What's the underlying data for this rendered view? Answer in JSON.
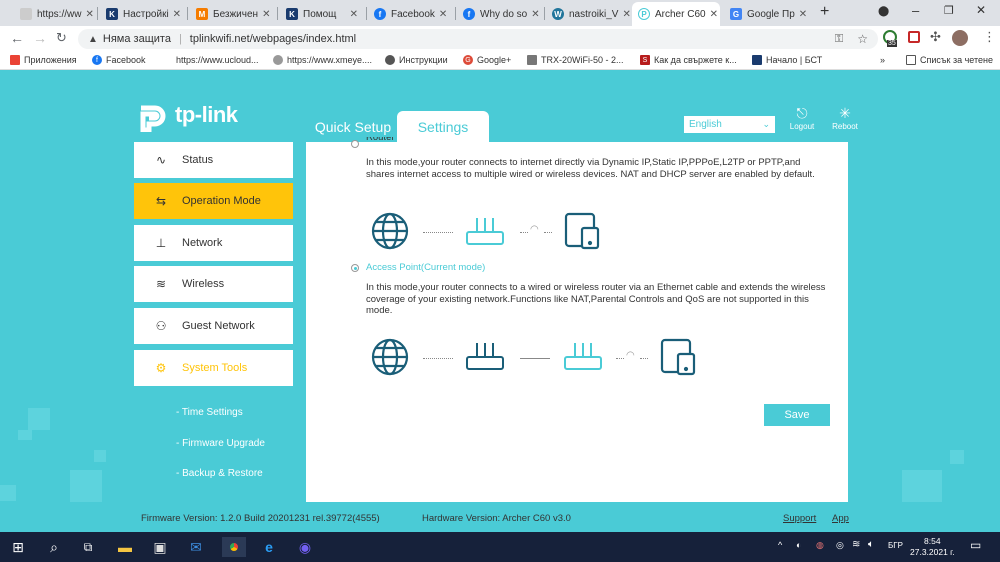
{
  "browser": {
    "tabs": [
      {
        "label": "https://ww",
        "icon": "page-icon"
      },
      {
        "label": "Настройкі",
        "icon": "k-icon"
      },
      {
        "label": "Безжичен",
        "icon": "m-icon"
      },
      {
        "label": "Помощ",
        "icon": "k-icon"
      },
      {
        "label": "Facebook",
        "icon": "facebook-icon"
      },
      {
        "label": "Why do so",
        "icon": "facebook-icon"
      },
      {
        "label": "nastroiki_V",
        "icon": "wordpress-icon"
      },
      {
        "label": "Archer C60",
        "icon": "tplink-icon"
      },
      {
        "label": "Google Пр",
        "icon": "google-translate-icon"
      }
    ],
    "new_tab": "+",
    "security_label": "Няма защита",
    "url": "tplinkwifi.net/webpages/index.html",
    "extension_badge": "35",
    "bookmarks": [
      {
        "label": "Приложения"
      },
      {
        "label": "Facebook"
      },
      {
        "label": "https://www.ucloud..."
      },
      {
        "label": "https://www.xmeye...."
      },
      {
        "label": "Инструкции"
      },
      {
        "label": "Google+"
      },
      {
        "label": "TRX-20WiFi-50 - 2..."
      },
      {
        "label": "Как да свържете к..."
      },
      {
        "label": "Начало | БСТ"
      }
    ],
    "bookmarks_more": "»",
    "reading_list": "Списък за четене"
  },
  "router": {
    "brand": "tp-link",
    "tabs": {
      "quick_setup": "Quick Setup",
      "settings": "Settings"
    },
    "language": "English",
    "logout": "Logout",
    "reboot": "Reboot",
    "menu": [
      {
        "label": "Status",
        "icon": "status-icon"
      },
      {
        "label": "Operation Mode",
        "icon": "operation-mode-icon"
      },
      {
        "label": "Network",
        "icon": "network-icon"
      },
      {
        "label": "Wireless",
        "icon": "wireless-icon"
      },
      {
        "label": "Guest Network",
        "icon": "guest-network-icon"
      },
      {
        "label": "System Tools",
        "icon": "system-tools-icon"
      }
    ],
    "submenu": [
      {
        "label": "- Time Settings"
      },
      {
        "label": "- Firmware Upgrade"
      },
      {
        "label": "- Backup & Restore"
      }
    ],
    "router_mode": {
      "label": "Router",
      "description": "In this mode,your router connects to internet directly via Dynamic IP,Static IP,PPPoE,L2TP or PPTP,and shares internet access to multiple wired or wireless devices. NAT and DHCP server are enabled by default."
    },
    "ap_mode": {
      "label": "Access Point(Current mode)",
      "description": "In this mode,your router connects to a wired or wireless router via an Ethernet cable and extends the wireless coverage of your existing network.Functions like NAT,Parental Controls and QoS are not supported in this mode."
    },
    "save": "Save",
    "firmware": "Firmware Version: 1.2.0 Build 20201231 rel.39772(4555)",
    "hardware": "Hardware Version: Archer C60 v3.0",
    "support": "Support",
    "app": "App"
  },
  "taskbar": {
    "language": "БГР",
    "time": "8:54",
    "date": "27.3.2021 г."
  },
  "colors": {
    "accent": "#4acbd6",
    "highlight": "#ffc40a",
    "icon": "#1a5e78"
  }
}
